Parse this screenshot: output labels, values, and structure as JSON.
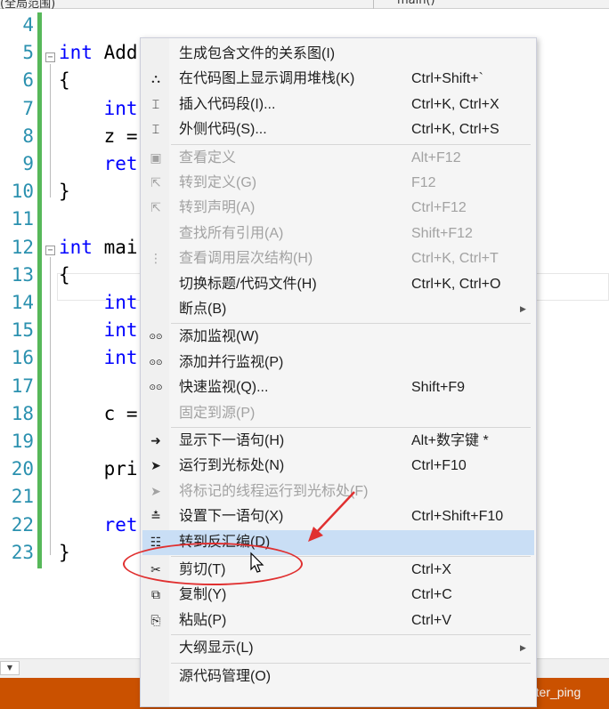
{
  "navbar": {
    "scope": "(全局范围)",
    "function": "main()"
  },
  "editor": {
    "lines": [
      {
        "num": "4",
        "tokens": []
      },
      {
        "num": "5",
        "tokens": [
          {
            "t": "int",
            "kw": true
          },
          {
            "t": " Add"
          }
        ]
      },
      {
        "num": "6",
        "tokens": [
          {
            "t": "{"
          }
        ]
      },
      {
        "num": "7",
        "tokens": [
          {
            "t": "    "
          },
          {
            "t": "int",
            "kw": true
          }
        ]
      },
      {
        "num": "8",
        "tokens": [
          {
            "t": "    z ="
          }
        ]
      },
      {
        "num": "9",
        "tokens": [
          {
            "t": "    "
          },
          {
            "t": "ret",
            "kw": true
          }
        ]
      },
      {
        "num": "10",
        "tokens": [
          {
            "t": "}"
          }
        ]
      },
      {
        "num": "11",
        "tokens": []
      },
      {
        "num": "12",
        "tokens": [
          {
            "t": "int",
            "kw": true
          },
          {
            "t": " mai"
          }
        ]
      },
      {
        "num": "13",
        "tokens": [
          {
            "t": "{"
          }
        ]
      },
      {
        "num": "14",
        "tokens": [
          {
            "t": "    "
          },
          {
            "t": "int",
            "kw": true
          }
        ]
      },
      {
        "num": "15",
        "tokens": [
          {
            "t": "    "
          },
          {
            "t": "int",
            "kw": true
          }
        ]
      },
      {
        "num": "16",
        "tokens": [
          {
            "t": "    "
          },
          {
            "t": "int",
            "kw": true
          }
        ]
      },
      {
        "num": "17",
        "tokens": []
      },
      {
        "num": "18",
        "tokens": [
          {
            "t": "    c ="
          }
        ]
      },
      {
        "num": "19",
        "tokens": []
      },
      {
        "num": "20",
        "tokens": [
          {
            "t": "    pri"
          }
        ]
      },
      {
        "num": "21",
        "tokens": []
      },
      {
        "num": "22",
        "tokens": [
          {
            "t": "    "
          },
          {
            "t": "ret",
            "kw": true
          }
        ]
      },
      {
        "num": "23",
        "tokens": [
          {
            "t": "}"
          }
        ]
      }
    ]
  },
  "context_menu": {
    "items": [
      {
        "type": "item",
        "name": "generate-include-graph",
        "icon": "",
        "label": "生成包含文件的关系图(I)",
        "shortcut": ""
      },
      {
        "type": "item",
        "name": "show-call-stack-on-code-map",
        "icon": "code-map-icon",
        "label": "在代码图上显示调用堆栈(K)",
        "shortcut": "Ctrl+Shift+`"
      },
      {
        "type": "item",
        "name": "insert-snippet",
        "icon": "snippet-icon",
        "label": "插入代码段(I)...",
        "shortcut": "Ctrl+K, Ctrl+X"
      },
      {
        "type": "item",
        "name": "surround-with",
        "icon": "surround-icon",
        "label": "外侧代码(S)...",
        "shortcut": "Ctrl+K, Ctrl+S"
      },
      {
        "type": "sep"
      },
      {
        "type": "item",
        "name": "peek-definition",
        "icon": "peek-icon",
        "label": "查看定义",
        "shortcut": "Alt+F12",
        "disabled": true
      },
      {
        "type": "item",
        "name": "go-to-definition",
        "icon": "goto-definition-icon",
        "label": "转到定义(G)",
        "shortcut": "F12",
        "disabled": true
      },
      {
        "type": "item",
        "name": "go-to-declaration",
        "icon": "goto-declaration-icon",
        "label": "转到声明(A)",
        "shortcut": "Ctrl+F12",
        "disabled": true
      },
      {
        "type": "item",
        "name": "find-all-references",
        "icon": "",
        "label": "查找所有引用(A)",
        "shortcut": "Shift+F12",
        "disabled": true
      },
      {
        "type": "item",
        "name": "view-call-hierarchy",
        "icon": "call-hierarchy-icon",
        "label": "查看调用层次结构(H)",
        "shortcut": "Ctrl+K, Ctrl+T",
        "disabled": true
      },
      {
        "type": "item",
        "name": "toggle-header-code-file",
        "icon": "",
        "label": "切换标题/代码文件(H)",
        "shortcut": "Ctrl+K, Ctrl+O"
      },
      {
        "type": "item",
        "name": "breakpoint",
        "icon": "",
        "label": "断点(B)",
        "shortcut": "",
        "submenu": true
      },
      {
        "type": "sep"
      },
      {
        "type": "item",
        "name": "add-watch",
        "icon": "glasses-icon",
        "label": "添加监视(W)",
        "shortcut": ""
      },
      {
        "type": "item",
        "name": "add-parallel-watch",
        "icon": "glasses-icon",
        "label": "添加并行监视(P)",
        "shortcut": ""
      },
      {
        "type": "item",
        "name": "quick-watch",
        "icon": "glasses-icon",
        "label": "快速监视(Q)...",
        "shortcut": "Shift+F9"
      },
      {
        "type": "item",
        "name": "pin-to-source",
        "icon": "",
        "label": "固定到源(P)",
        "shortcut": "",
        "disabled": true
      },
      {
        "type": "sep"
      },
      {
        "type": "item",
        "name": "show-next-statement",
        "icon": "arrow-right-icon",
        "label": "显示下一语句(H)",
        "shortcut": "Alt+数字键 *"
      },
      {
        "type": "item",
        "name": "run-to-cursor",
        "icon": "cursor-arrow-icon",
        "label": "运行到光标处(N)",
        "shortcut": "Ctrl+F10"
      },
      {
        "type": "item",
        "name": "run-flagged-threads-to-cursor",
        "icon": "cursor-arrow-icon",
        "label": "将标记的线程运行到光标处(F)",
        "shortcut": "",
        "disabled": true
      },
      {
        "type": "item",
        "name": "set-next-statement",
        "icon": "set-next-statement-icon",
        "label": "设置下一语句(X)",
        "shortcut": "Ctrl+Shift+F10"
      },
      {
        "type": "item",
        "name": "go-to-disassembly",
        "icon": "disassembly-icon",
        "label": "转到反汇编(D)",
        "shortcut": "",
        "highlighted": true
      },
      {
        "type": "sep"
      },
      {
        "type": "item",
        "name": "cut",
        "icon": "scissors-icon",
        "label": "剪切(T)",
        "shortcut": "Ctrl+X"
      },
      {
        "type": "item",
        "name": "copy",
        "icon": "copy-icon",
        "label": "复制(Y)",
        "shortcut": "Ctrl+C"
      },
      {
        "type": "item",
        "name": "paste",
        "icon": "paste-icon",
        "label": "粘贴(P)",
        "shortcut": "Ctrl+V"
      },
      {
        "type": "sep"
      },
      {
        "type": "item",
        "name": "outlining",
        "icon": "",
        "label": "大纲显示(L)",
        "shortcut": "",
        "submenu": true
      },
      {
        "type": "sep"
      },
      {
        "type": "item",
        "name": "source-control",
        "icon": "",
        "label": "源代码管理(O)",
        "shortcut": ""
      }
    ]
  },
  "colors": {
    "keyword": "#0000ff",
    "line_number": "#2b91af",
    "change_bar": "#57b85a",
    "status_bar": "#ca5100",
    "menu_highlight": "#c9def5",
    "annotation": "#e03030"
  },
  "watermark": "CSDN @水瓶water_ping"
}
